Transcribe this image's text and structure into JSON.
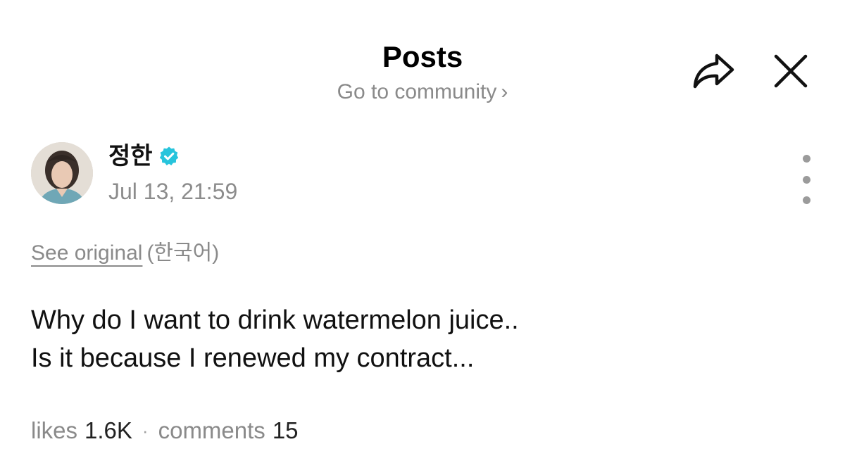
{
  "header": {
    "title": "Posts",
    "subtitle": "Go to community",
    "subtitle_chevron": "›",
    "share_icon": "share-arrow-icon",
    "close_icon": "close-icon"
  },
  "post": {
    "author": {
      "name": "정한",
      "verified": true,
      "timestamp": "Jul 13, 21:59"
    },
    "more_icon": "vertical-ellipsis-icon",
    "translation": {
      "see_original_label": "See original",
      "language": "(한국어)"
    },
    "body_lines": [
      "Why do I want to drink watermelon juice..",
      "Is it because I renewed my contract..."
    ],
    "stats": {
      "likes_label": "likes",
      "likes_count": "1.6K",
      "separator": "·",
      "comments_label": "comments",
      "comments_count": "15"
    }
  },
  "colors": {
    "verified_badge": "#27c4dc",
    "muted_text": "#8a8a8a",
    "primary_text": "#111111"
  }
}
